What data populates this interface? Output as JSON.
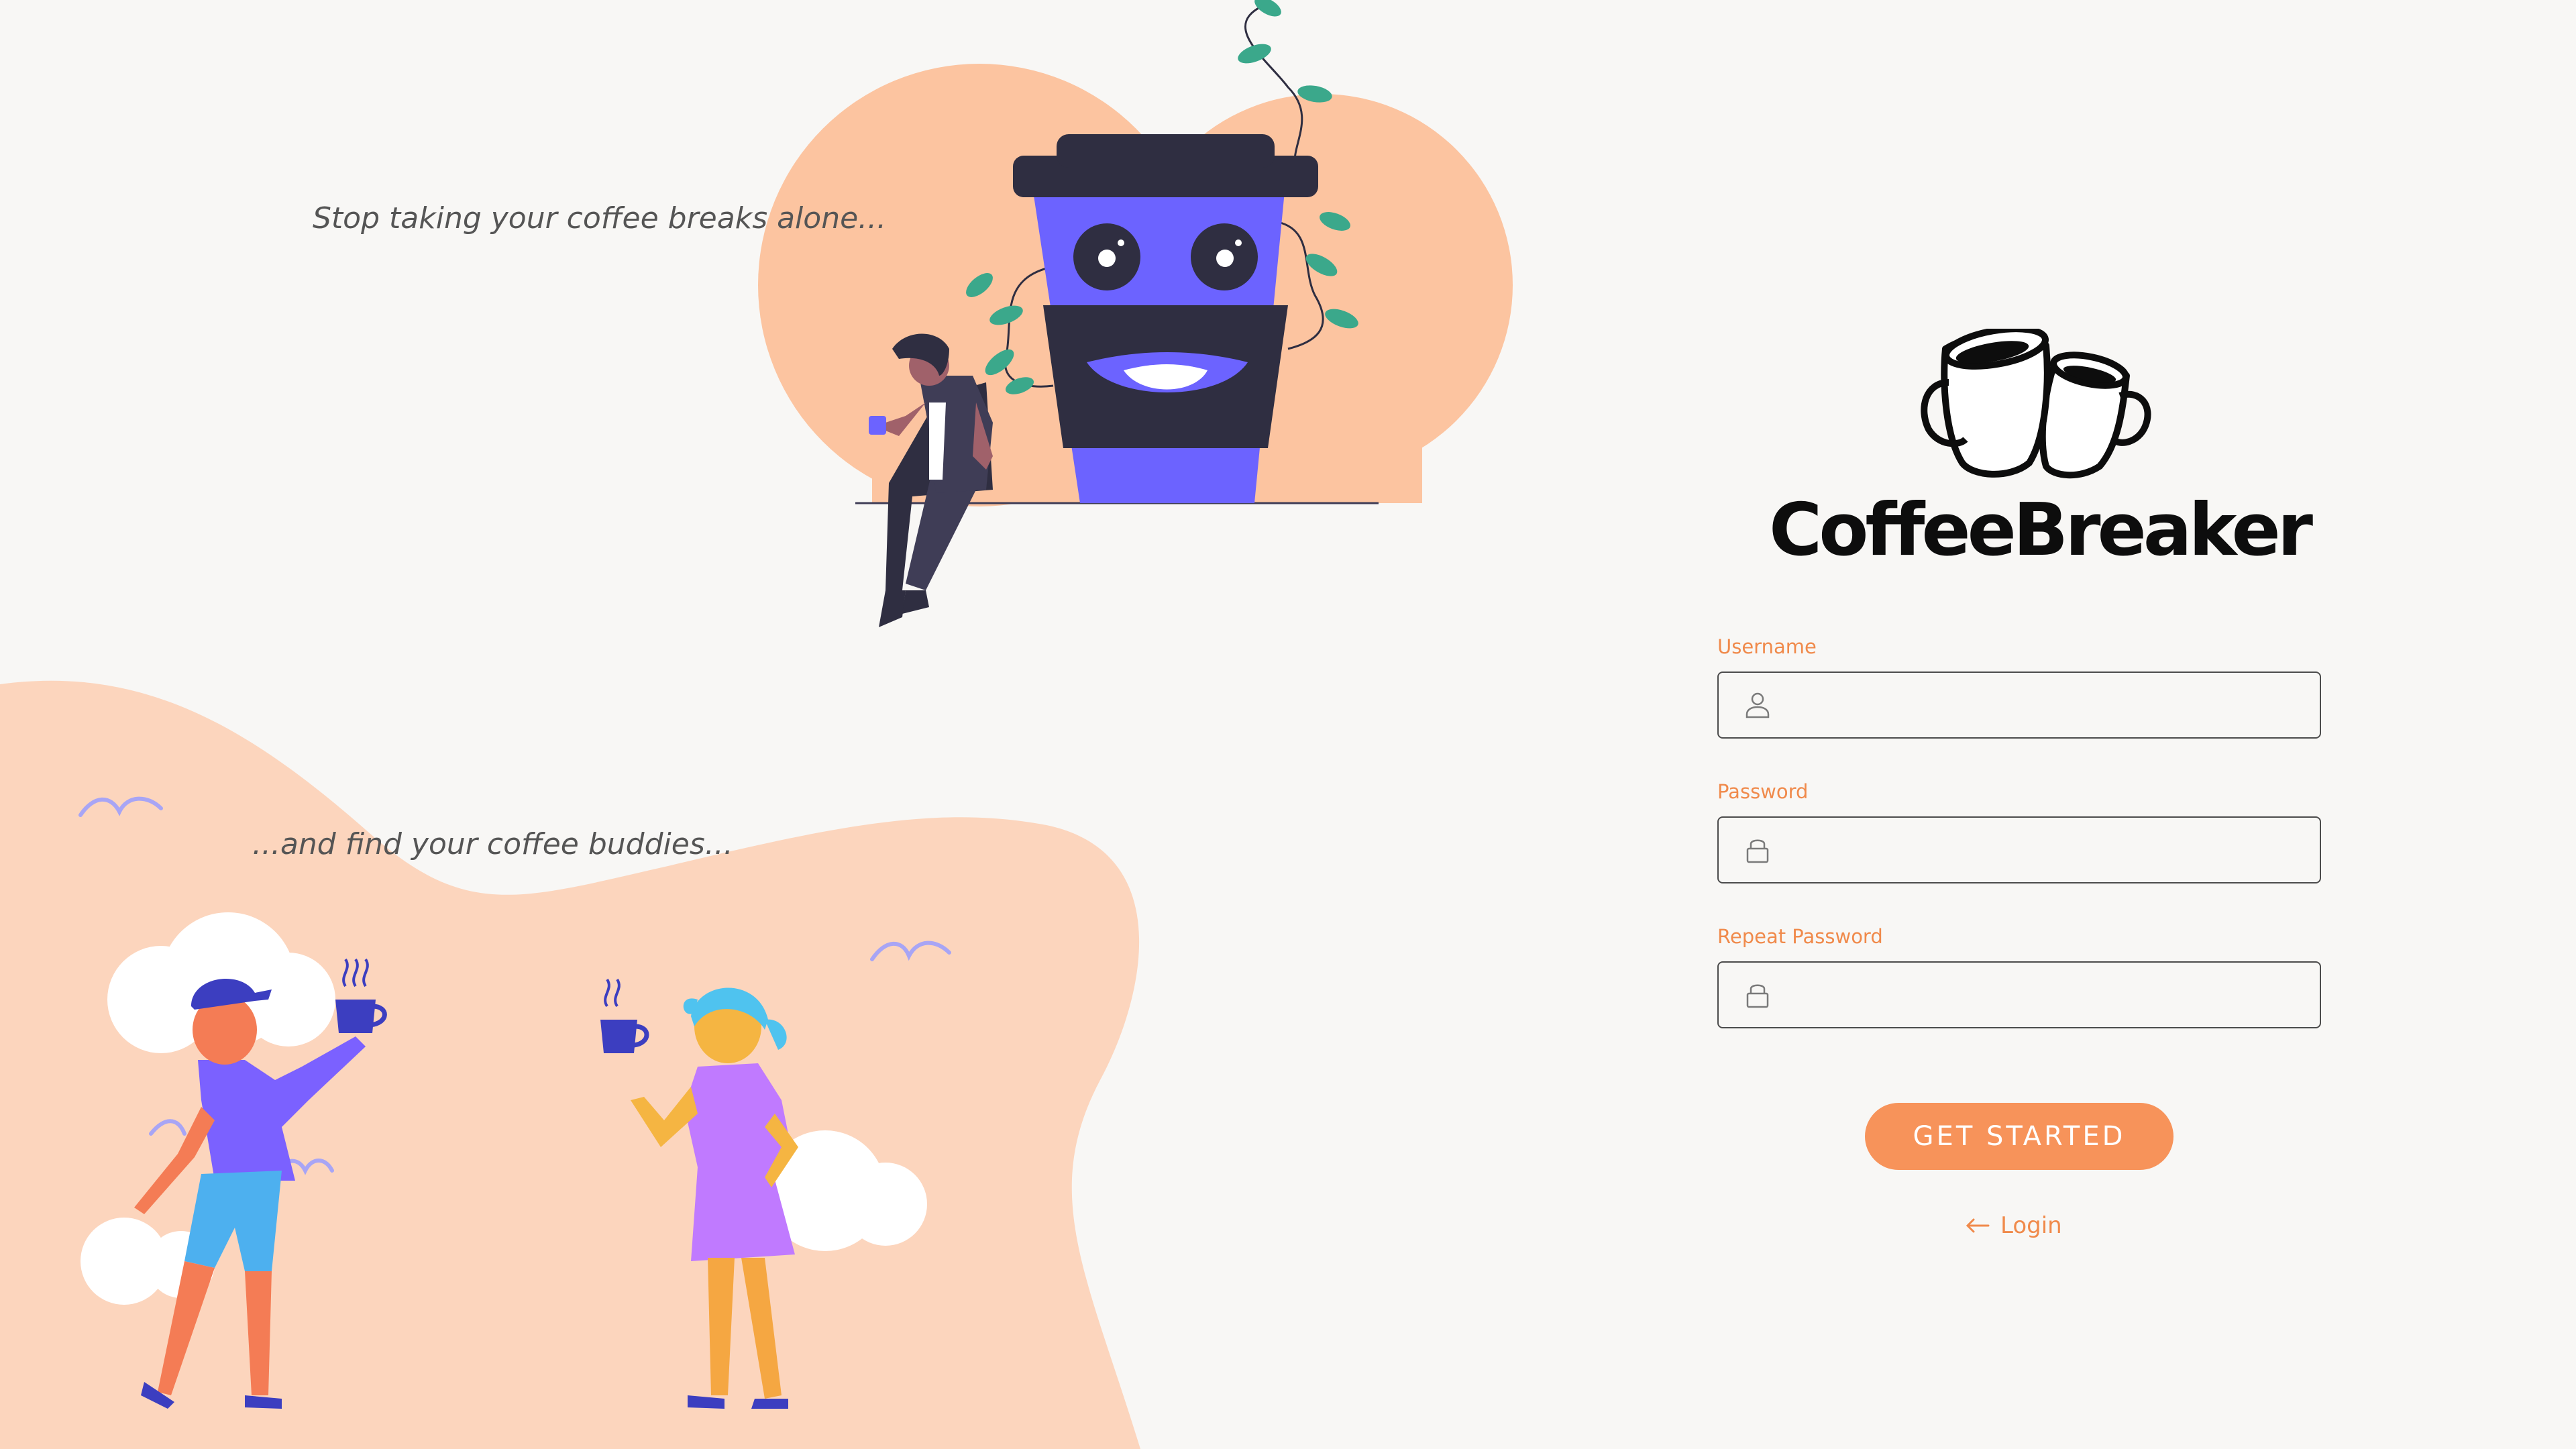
{
  "hero": {
    "tagline_top": "Stop taking your coffee breaks alone...",
    "tagline_bottom": "...and find your coffee buddies..."
  },
  "brand": {
    "name": "CoffeeBreaker",
    "logo_icon": "two-coffee-cups-icon"
  },
  "form": {
    "username": {
      "label": "Username",
      "value": "",
      "placeholder": "",
      "icon": "user-icon"
    },
    "password": {
      "label": "Password",
      "value": "",
      "placeholder": "",
      "icon": "lock-icon"
    },
    "repeat_password": {
      "label": "Repeat Password",
      "value": "",
      "placeholder": "",
      "icon": "lock-icon"
    },
    "submit_label": "GET STARTED",
    "login_link": {
      "label": "Login",
      "icon": "arrow-left-icon"
    }
  },
  "colors": {
    "accent": "#f7935a",
    "label": "#f08a4b",
    "peach": "#fcc4a0",
    "peach_light": "#fcd5bd",
    "cup_purple": "#6c63ff",
    "cup_dark": "#2f2e41",
    "background": "#f8f7f5"
  }
}
